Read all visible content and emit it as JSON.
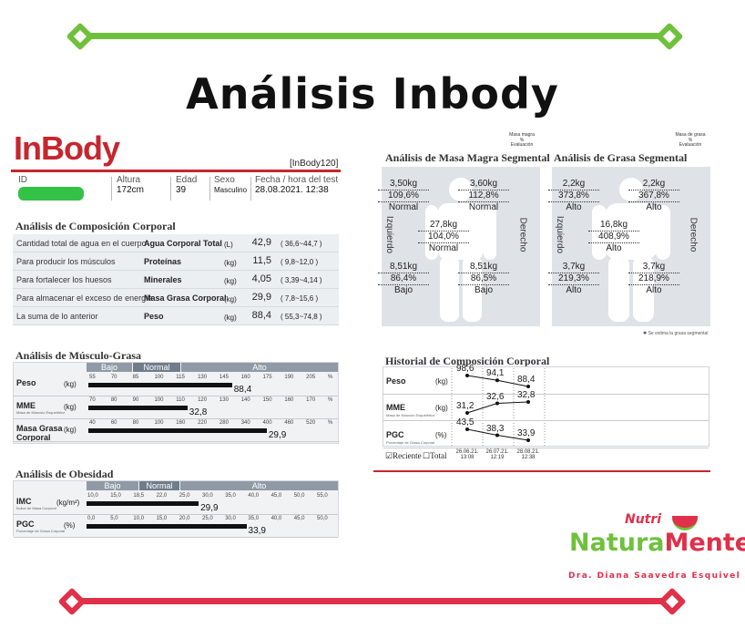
{
  "title": "Análisis Inbody",
  "header": {
    "logo": "InBody",
    "model": "[InBody120]",
    "id_label": "ID",
    "height_label": "Altura",
    "height_value": "172cm",
    "age_label": "Edad",
    "age_value": "39",
    "sex_label": "Sexo",
    "sex_value": "Masculino",
    "date_label": "Fecha / hora del test",
    "date_value": "28.08.2021. 12:38"
  },
  "composition": {
    "title": "Análisis de Composición Corporal",
    "rows": [
      {
        "desc": "Cantidad total de agua en el cuerpo",
        "name": "Agua Corporal Total",
        "unit": "(L)",
        "value": "42,9",
        "range": "( 36,6~44,7 )"
      },
      {
        "desc": "Para producir los músculos",
        "name": "Proteínas",
        "unit": "(kg)",
        "value": "11,5",
        "range": "( 9,8~12,0 )"
      },
      {
        "desc": "Para fortalecer los huesos",
        "name": "Minerales",
        "unit": "(kg)",
        "value": "4,05",
        "range": "( 3,39~4,14 )"
      },
      {
        "desc": "Para almacenar el exceso de energía",
        "name": "Masa Grasa Corporal",
        "unit": "(kg)",
        "value": "29,9",
        "range": "( 7,8~15,6 )"
      },
      {
        "desc": "La suma de lo anterior",
        "name": "Peso",
        "unit": "(kg)",
        "value": "88,4",
        "range": "( 55,3~74,8 )"
      }
    ]
  },
  "muscle_fat": {
    "title": "Análisis de Músculo-Grasa",
    "bands": {
      "low": "Bajo",
      "normal": "Normal",
      "high": "Alto"
    },
    "rows": [
      {
        "label": "Peso",
        "sub": "",
        "unit": "(kg)",
        "ticks": [
          "55",
          "70",
          "85",
          "100",
          "115",
          "130",
          "145",
          "160",
          "175",
          "190",
          "205",
          "%"
        ],
        "value": "88,4",
        "fill": 0.58
      },
      {
        "label": "MME",
        "sub": "Masa de Músculo Esquelético",
        "unit": "(kg)",
        "ticks": [
          "70",
          "80",
          "90",
          "100",
          "110",
          "120",
          "130",
          "140",
          "150",
          "160",
          "170",
          "%"
        ],
        "value": "32,8",
        "fill": 0.4
      },
      {
        "label": "Masa Grasa",
        "label2": "Corporal",
        "sub": "",
        "unit": "(kg)",
        "ticks": [
          "40",
          "60",
          "80",
          "100",
          "160",
          "220",
          "280",
          "340",
          "400",
          "460",
          "520",
          "%"
        ],
        "value": "29,9",
        "fill": 0.72
      }
    ]
  },
  "obesity": {
    "title": "Análisis de Obesidad",
    "bands": {
      "low": "Bajo",
      "normal": "Normal",
      "high": "Alto"
    },
    "rows": [
      {
        "label": "IMC",
        "sub": "Índice de Masa Corporal",
        "unit": "(kg/m²)",
        "ticks": [
          "10,0",
          "15,0",
          "18,5",
          "22,0",
          "25,0",
          "30,0",
          "35,0",
          "40,0",
          "45,0",
          "50,0",
          "55,0"
        ],
        "value": "29,9",
        "fill": 0.47
      },
      {
        "label": "PGC",
        "sub": "Porcentaje de Grasa Corporal",
        "unit": "(%)",
        "ticks": [
          "0,0",
          "5,0",
          "10,0",
          "15,0",
          "20,0",
          "25,0",
          "30,0",
          "35,0",
          "40,0",
          "45,0",
          "50,0"
        ],
        "value": "33,9",
        "fill": 0.67
      }
    ]
  },
  "lean_segmental": {
    "title": "Análisis de Masa Magra Segmental",
    "legend": [
      "Masa magra",
      "%",
      "Evaluación"
    ],
    "left_side": "Izquierdo",
    "right_side": "Derecho",
    "left_arm": {
      "kg": "3,50kg",
      "pct": "109,6%",
      "eval": "Normal"
    },
    "right_arm": {
      "kg": "3,60kg",
      "pct": "112,8%",
      "eval": "Normal"
    },
    "trunk": {
      "kg": "27,8kg",
      "pct": "104,0%",
      "eval": "Normal"
    },
    "left_leg": {
      "kg": "8,51kg",
      "pct": "86,4%",
      "eval": "Bajo"
    },
    "right_leg": {
      "kg": "8,51kg",
      "pct": "86,5%",
      "eval": "Bajo"
    }
  },
  "fat_segmental": {
    "title": "Análisis de Grasa Segmental",
    "legend": [
      "Masa de grasa",
      "%",
      "Evaluación"
    ],
    "left_side": "Izquierdo",
    "right_side": "Derecho",
    "left_arm": {
      "kg": "2,2kg",
      "pct": "373,8%",
      "eval": "Alto"
    },
    "right_arm": {
      "kg": "2,2kg",
      "pct": "367,8%",
      "eval": "Alto"
    },
    "trunk": {
      "kg": "16,8kg",
      "pct": "408,9%",
      "eval": "Alto"
    },
    "left_leg": {
      "kg": "3,7kg",
      "pct": "219,3%",
      "eval": "Alto"
    },
    "right_leg": {
      "kg": "3,7kg",
      "pct": "218,9%",
      "eval": "Alto"
    },
    "note": "✱ Se estima la grasa segmental"
  },
  "history": {
    "title": "Historial de Composición Corporal",
    "rows": [
      {
        "label": "Peso",
        "sub": "",
        "unit": "(kg)",
        "values": [
          "98,6",
          "94,1",
          "88,4"
        ]
      },
      {
        "label": "MME",
        "sub": "Masa de Músculo Esquelético",
        "unit": "(kg)",
        "values": [
          "31,2",
          "32,6",
          "32,8"
        ]
      },
      {
        "label": "PGC",
        "sub": "Porcentaje de Grasa Corporal",
        "unit": "(%)",
        "values": [
          "43,5",
          "38,3",
          "33,9"
        ]
      }
    ],
    "dates": [
      {
        "date": "26.06.21.",
        "time": "13:08"
      },
      {
        "date": "26.07.21.",
        "time": "12:19"
      },
      {
        "date": "28.08.21.",
        "time": "12:38"
      }
    ],
    "recent_label": "Reciente",
    "total_label": "Total"
  },
  "brand": {
    "nutri": "Nutri",
    "name_a": "Natura",
    "name_b": "Mente",
    "tagline": "Dra. Diana Saavedra Esquivel"
  },
  "colors": {
    "green": "#6fc13c",
    "red": "#e0304a",
    "inbody_red": "#c6262e"
  }
}
